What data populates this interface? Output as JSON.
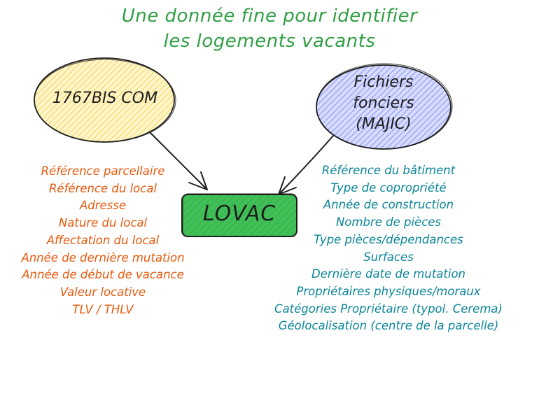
{
  "title": {
    "line1": "Une donnée fine pour identifier",
    "line2": "les logements vacants"
  },
  "nodes": {
    "left": {
      "label": "1767BIS COM"
    },
    "right": {
      "lines": [
        "Fichiers",
        "fonciers",
        "(MAJIC)"
      ]
    },
    "center": {
      "label": "LOVAC"
    }
  },
  "left_list": [
    "Référence parcellaire",
    "Référence du local",
    "Adresse",
    "Nature du local",
    "Affectation du local",
    "Année de dernière mutation",
    "Année de début de vacance",
    "Valeur locative",
    "TLV / THLV"
  ],
  "right_list": [
    "Référence du bâtiment",
    "Type de copropriété",
    "Année de construction",
    "Nombre de pièces",
    "Type pièces/dépendances",
    "Surfaces",
    "Dernière date de mutation",
    "Propriétaires physiques/moraux",
    "Catégories Propriétaire (typol. Cerema)",
    "Géolocalisation (centre de la parcelle)"
  ],
  "colors": {
    "title": "#2f9e44",
    "left_fill": "#ffec99",
    "left_stroke": "#e8b923",
    "right_fill": "#a5b4fc",
    "right_stroke": "#3b4bdb",
    "center_fill": "#40c057",
    "left_text": "#e8590c",
    "right_text": "#0c8599",
    "ink": "#1e1e1e"
  }
}
